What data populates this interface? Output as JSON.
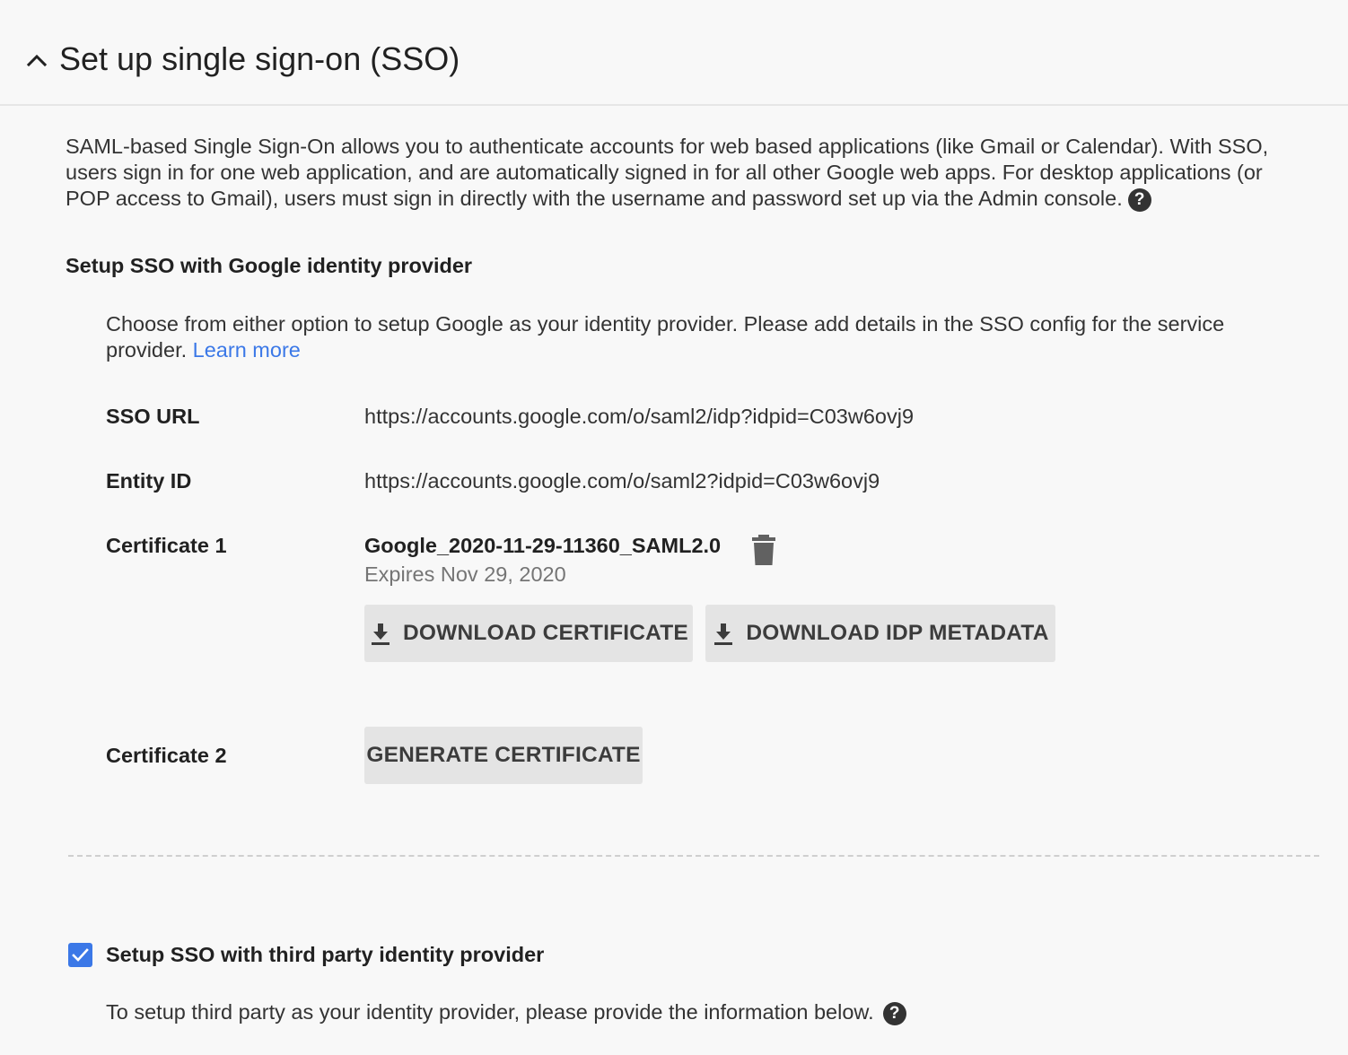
{
  "header": {
    "title": "Set up single sign-on (SSO)",
    "collapse_icon": "chevron-up-icon"
  },
  "intro": {
    "text": "SAML-based Single Sign-On allows you to authenticate accounts for web based applications (like Gmail or Calendar). With SSO, users sign in for one web application, and are automatically signed in for all other Google web apps. For desktop applications (or POP access to Gmail), users must sign in directly with the username and password set up via the Admin console.",
    "help_icon": "help-icon"
  },
  "google_idp": {
    "heading": "Setup SSO with Google identity provider",
    "description": "Choose from either option to setup Google as your identity provider. Please add details in the SSO config for the service provider.",
    "learn_more": "Learn more",
    "sso_url_label": "SSO URL",
    "sso_url_value": "https://accounts.google.com/o/saml2/idp?idpid=C03w6ovj9",
    "entity_id_label": "Entity ID",
    "entity_id_value": "https://accounts.google.com/o/saml2?idpid=C03w6ovj9",
    "cert1_label": "Certificate 1",
    "cert1_name": "Google_2020-11-29-11360_SAML2.0",
    "cert1_expires": "Expires Nov 29, 2020",
    "download_certificate": "DOWNLOAD CERTIFICATE",
    "download_idp_metadata": "DOWNLOAD IDP METADATA",
    "cert2_label": "Certificate 2",
    "generate_certificate": "GENERATE CERTIFICATE"
  },
  "third_party": {
    "checked": true,
    "label": "Setup SSO with third party identity provider",
    "description": "To setup third party as your identity provider, please provide the information below."
  },
  "colors": {
    "link": "#3b78e7",
    "checkbox": "#3b78e7",
    "button_bg": "#e4e4e4",
    "background": "#f8f8f8"
  }
}
